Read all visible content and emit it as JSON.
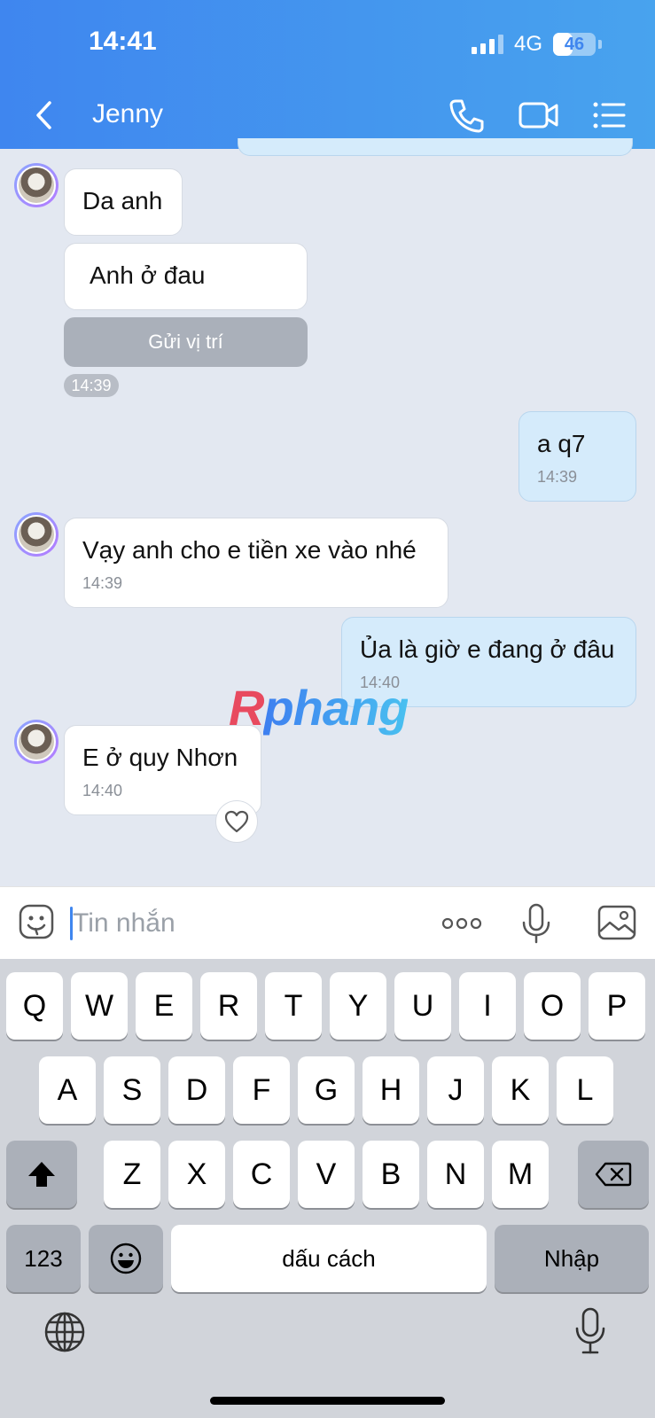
{
  "status": {
    "time": "14:41",
    "network": "4G",
    "battery": "46"
  },
  "header": {
    "contact_name": "Jenny"
  },
  "messages": [
    {
      "text": "Da anh"
    },
    {
      "text": "Anh ở đau"
    },
    {
      "button": "Gửi vị trí",
      "time": "14:39"
    },
    {
      "text": "a q7",
      "time": "14:39"
    },
    {
      "text": "Vạy anh cho e tiền xe vào nhé",
      "time": "14:39"
    },
    {
      "text": "Ủa là giờ e đang ở đâu",
      "time": "14:40"
    },
    {
      "text": "E ở quy Nhơn",
      "time": "14:40"
    }
  ],
  "watermark": {
    "first": "R",
    "rest": "phang"
  },
  "input": {
    "placeholder": "Tin nhắn"
  },
  "keyboard": {
    "row1": [
      "Q",
      "W",
      "E",
      "R",
      "T",
      "Y",
      "U",
      "I",
      "O",
      "P"
    ],
    "row2": [
      "A",
      "S",
      "D",
      "F",
      "G",
      "H",
      "J",
      "K",
      "L"
    ],
    "row3": [
      "Z",
      "X",
      "C",
      "V",
      "B",
      "N",
      "M"
    ],
    "numbers_key": "123",
    "space_key": "dấu cách",
    "return_key": "Nhập"
  }
}
